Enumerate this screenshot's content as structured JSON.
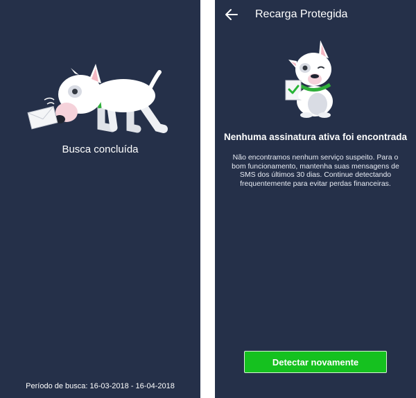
{
  "left_screen": {
    "status_title": "Busca concluída",
    "search_period": "Período de busca: 16-03-2018 - 16-04-2018"
  },
  "right_screen": {
    "app_bar_title": "Recarga Protegida",
    "headline": "Nenhuma assinatura ativa foi encontrada",
    "description": "Não encontramos nenhum serviço suspeito. Para o bom funcionamento, mantenha suas mensagens de SMS dos últimos 30 dias. Continue detectando frequentemente para evitar perdas financeiras.",
    "action_button": "Detectar novamente"
  },
  "icons": {
    "back": "arrow-left-icon",
    "sniffing_dog": "dog-sniffing-envelope-illustration",
    "sitting_dog": "dog-holding-checklist-illustration"
  },
  "colors": {
    "background": "#253049",
    "accent_green": "#15c11f",
    "text": "#ffffff"
  }
}
